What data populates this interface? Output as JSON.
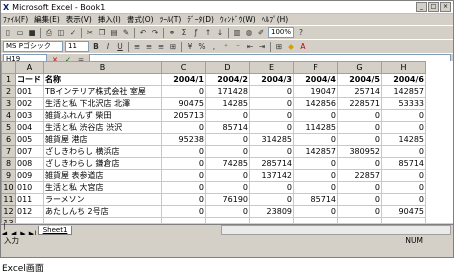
{
  "window": {
    "title": "Microsoft Excel - Book1",
    "controls": [
      "_",
      "□",
      "×"
    ]
  },
  "menubar": {
    "items": [
      "ﾌｧｲﾙ(F)",
      "編集(E)",
      "表示(V)",
      "挿入(I)",
      "書式(O)",
      "ﾂｰﾙ(T)",
      "ﾃﾞｰﾀ(D)",
      "ｳｨﾝﾄﾞｳ(W)",
      "ﾍﾙﾌﾟ(H)"
    ],
    "right": "_ | 8 | ×"
  },
  "toolbar1": {
    "zoom": "100%"
  },
  "toolbar2": {
    "font": "MS Pゴシック",
    "size": "11",
    "bold": "B",
    "italic": "I",
    "underline": "U"
  },
  "formula_bar": {
    "name_box": "H19",
    "cancel": "×",
    "enter": "✓",
    "fx": "="
  },
  "sheet": {
    "columns": [
      "",
      "A",
      "B",
      "C",
      "D",
      "E",
      "F",
      "G",
      "H"
    ],
    "rows": [
      [
        "1",
        "コード",
        "名称",
        "2004/1",
        "2004/2",
        "2004/3",
        "2004/4",
        "2004/5",
        "2004/6"
      ],
      [
        "2",
        "001",
        "TBインテリア株式会社 室屋",
        "0",
        "171428",
        "0",
        "19047",
        "25714",
        "142857"
      ],
      [
        "3",
        "002",
        "生活と私 下北沢店 北澤",
        "90475",
        "14285",
        "0",
        "142856",
        "228571",
        "53333"
      ],
      [
        "4",
        "003",
        "雑貨ふれんず 柴田",
        "205713",
        "0",
        "0",
        "0",
        "0",
        "0"
      ],
      [
        "5",
        "004",
        "生活と私 渋谷店 渋沢",
        "0",
        "85714",
        "0",
        "114285",
        "0",
        "0"
      ],
      [
        "6",
        "005",
        "雑貨屋 港店",
        "95238",
        "0",
        "314285",
        "0",
        "0",
        "14285"
      ],
      [
        "7",
        "007",
        "ざしきわらし 横浜店",
        "0",
        "0",
        "0",
        "142857",
        "380952",
        "0"
      ],
      [
        "8",
        "008",
        "ざしきわらし 鎌倉店",
        "0",
        "74285",
        "285714",
        "0",
        "0",
        "85714"
      ],
      [
        "9",
        "009",
        "雑貨屋 表参道店",
        "0",
        "0",
        "137142",
        "0",
        "22857",
        "0"
      ],
      [
        "10",
        "010",
        "生活と私 大宮店",
        "0",
        "0",
        "0",
        "0",
        "0",
        "0"
      ],
      [
        "11",
        "011",
        "ラーメソン",
        "0",
        "76190",
        "0",
        "85714",
        "0",
        "0"
      ],
      [
        "12",
        "012",
        "あたしんち 2号店",
        "0",
        "0",
        "23809",
        "0",
        "0",
        "90475"
      ],
      [
        "13",
        "",
        "",
        "",
        "",
        "",
        "",
        "",
        ""
      ]
    ]
  },
  "tabs": {
    "sheet_name": "Sheet1"
  },
  "status": {
    "left": "入力",
    "right": "NUM"
  },
  "caption": "Excel画面"
}
